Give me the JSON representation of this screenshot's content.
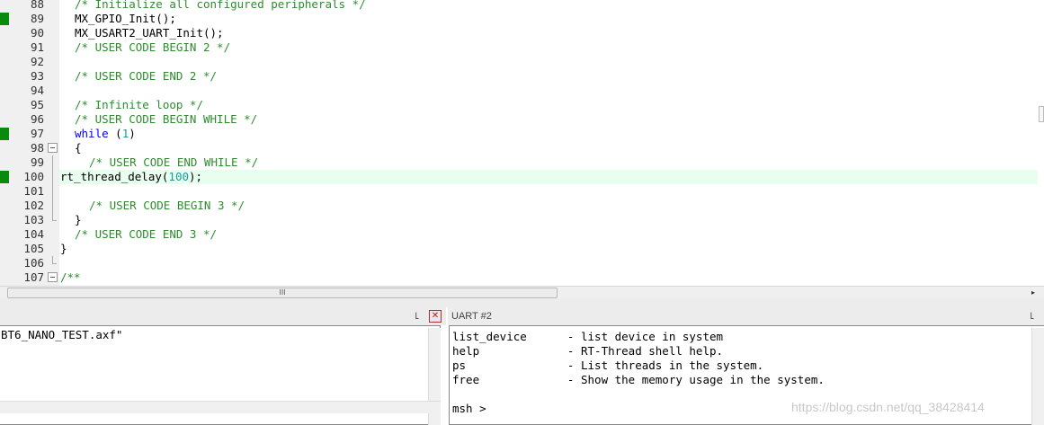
{
  "editor": {
    "lines": [
      {
        "num": "88",
        "code": "/* Initialize all configured peripherals */",
        "type": "comment",
        "indent": 1
      },
      {
        "num": "89",
        "code": "MX_GPIO_Init();",
        "type": "plain",
        "indent": 1
      },
      {
        "num": "90",
        "code": "MX_USART2_UART_Init();",
        "type": "plain",
        "indent": 1
      },
      {
        "num": "91",
        "code": "/* USER CODE BEGIN 2 */",
        "type": "comment",
        "indent": 1
      },
      {
        "num": "92",
        "code": "",
        "type": "plain",
        "indent": 1
      },
      {
        "num": "93",
        "code": "/* USER CODE END 2 */",
        "type": "comment",
        "indent": 1
      },
      {
        "num": "94",
        "code": "",
        "type": "plain",
        "indent": 1
      },
      {
        "num": "95",
        "code": "/* Infinite loop */",
        "type": "comment",
        "indent": 1
      },
      {
        "num": "96",
        "code": "/* USER CODE BEGIN WHILE */",
        "type": "comment",
        "indent": 1
      },
      {
        "num": "97",
        "code": "while (1)",
        "type": "while",
        "indent": 1
      },
      {
        "num": "98",
        "code": "{",
        "type": "plain",
        "indent": 1
      },
      {
        "num": "99",
        "code": "/* USER CODE END WHILE */",
        "type": "comment",
        "indent": 2
      },
      {
        "num": "100",
        "code": "rt_thread_delay(100);",
        "type": "call",
        "indent": 0
      },
      {
        "num": "101",
        "code": "",
        "type": "plain",
        "indent": 1
      },
      {
        "num": "102",
        "code": "/* USER CODE BEGIN 3 */",
        "type": "comment",
        "indent": 2
      },
      {
        "num": "103",
        "code": "}",
        "type": "plain",
        "indent": 1
      },
      {
        "num": "104",
        "code": "/* USER CODE END 3 */",
        "type": "comment",
        "indent": 1
      },
      {
        "num": "105",
        "code": "}",
        "type": "plain",
        "indent": 0
      },
      {
        "num": "106",
        "code": "",
        "type": "plain",
        "indent": 0
      },
      {
        "num": "107",
        "code": "/**",
        "type": "comment",
        "indent": 0
      }
    ],
    "breakpoint_lines": [
      "89",
      "97",
      "100"
    ],
    "current_line": "100",
    "hscroll_grip": "III",
    "hscroll_arrow": "▸"
  },
  "build_pane": {
    "pin": "꜖",
    "close": "✕",
    "output": "BT6_NANO_TEST.axf\""
  },
  "uart_pane": {
    "title": "UART #2",
    "pin": "꜖",
    "lines": [
      "list_device      - list device in system",
      "help             - RT-Thread shell help.",
      "ps               - List threads in the system.",
      "free             - Show the memory usage in the system.",
      "",
      "msh >"
    ]
  },
  "watermark": "https://blog.csdn.net/qq_38428414",
  "colors": {
    "comment": "#2e8b2e",
    "keyword": "#0000ee",
    "number": "#1a9a9a",
    "breakpoint": "#0a8a0a",
    "current_line_bg": "#e8fff0"
  }
}
